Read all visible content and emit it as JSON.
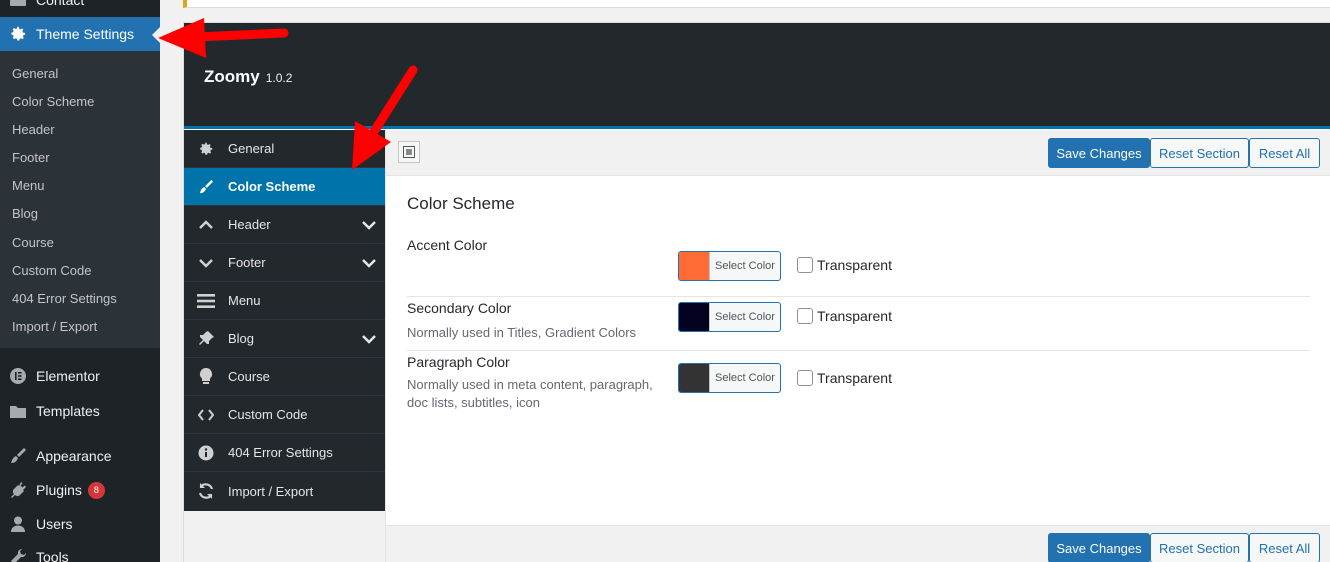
{
  "wp_menu": {
    "contact_label": "Contact",
    "active_label": "Theme Settings",
    "submenu": [
      "General",
      "Color Scheme",
      "Header",
      "Footer",
      "Menu",
      "Blog",
      "Course",
      "Custom Code",
      "404 Error Settings",
      "Import / Export"
    ],
    "items": [
      {
        "label": "Elementor",
        "icon": "elementor-icon"
      },
      {
        "label": "Templates",
        "icon": "folder-icon"
      },
      {
        "label": "Appearance",
        "icon": "paintbrush-icon"
      },
      {
        "label": "Plugins",
        "icon": "plug-icon",
        "badge": "8"
      },
      {
        "label": "Users",
        "icon": "user-icon"
      },
      {
        "label": "Tools",
        "icon": "wrench-icon"
      }
    ]
  },
  "panel": {
    "brand": "Zoomy",
    "version": "1.0.2"
  },
  "options_nav": [
    {
      "label": "General",
      "icon": "gear-icon"
    },
    {
      "label": "Color Scheme",
      "icon": "paint-brush-icon",
      "active": true
    },
    {
      "label": "Header",
      "icon": "chevron-up-icon",
      "expandable": true
    },
    {
      "label": "Footer",
      "icon": "chevron-down-icon",
      "expandable": true
    },
    {
      "label": "Menu",
      "icon": "hamburger-icon"
    },
    {
      "label": "Blog",
      "icon": "pushpin-icon",
      "expandable": true
    },
    {
      "label": "Course",
      "icon": "lightbulb-icon"
    },
    {
      "label": "Custom Code",
      "icon": "code-icon"
    },
    {
      "label": "404 Error Settings",
      "icon": "info-icon"
    },
    {
      "label": "Import / Export",
      "icon": "refresh-icon"
    }
  ],
  "toolbar": {
    "save": "Save Changes",
    "reset_section": "Reset Section",
    "reset_all": "Reset All"
  },
  "section": {
    "title": "Color Scheme",
    "fields": [
      {
        "label": "Accent Color",
        "desc": "",
        "color": "#ff6b35",
        "button": "Select Color",
        "transparent": "Transparent"
      },
      {
        "label": "Secondary Color",
        "desc": "Normally used in Titles, Gradient Colors",
        "color": "#050221",
        "button": "Select Color",
        "transparent": "Transparent"
      },
      {
        "label": "Paragraph Color",
        "desc": "Normally used in meta content, paragraph, doc lists, subtitles, icon",
        "color": "#333333",
        "button": "Select Color",
        "transparent": "Transparent"
      }
    ]
  },
  "colors": {
    "wp_sidebar": "#1d2327",
    "wp_active": "#2271b1",
    "panel_header": "#23282d",
    "nav_active": "#0073aa",
    "annotation_arrow": "#ff0000"
  }
}
